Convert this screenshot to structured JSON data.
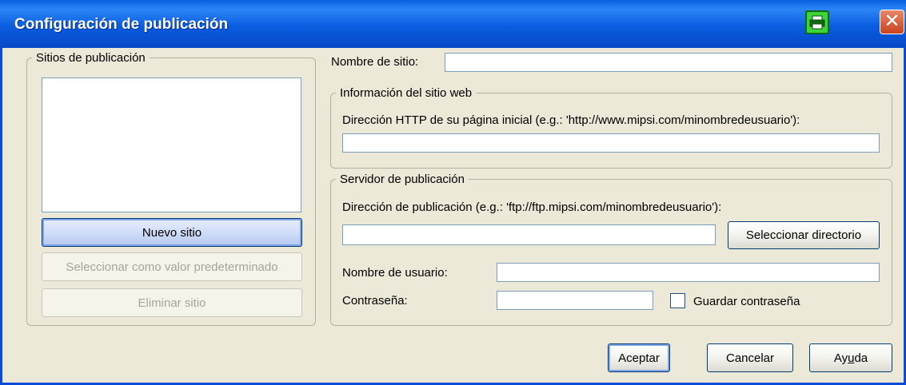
{
  "window": {
    "title": "Configuración de publicación",
    "close_glyph": "✕",
    "app_icon": "printer-icon",
    "accent": "#0a4bd8"
  },
  "sites_group": {
    "legend": "Sitios de publicación",
    "new_site_label": "Nuevo sitio",
    "set_default_label": "Seleccionar como valor predeterminado",
    "delete_site_label": "Eliminar sitio"
  },
  "site_name": {
    "label": "Nombre de sitio:",
    "value": ""
  },
  "website_group": {
    "legend": "Información del sitio web",
    "http_label": "Dirección HTTP de su página inicial (e.g.: 'http://www.mipsi.com/minombredeusuario'):",
    "http_value": ""
  },
  "server_group": {
    "legend": "Servidor de publicación",
    "publish_label": "Dirección de publicación (e.g.: 'ftp://ftp.mipsi.com/minombredeusuario'):",
    "publish_value": "",
    "select_dir_label": "Seleccionar directorio",
    "username_label": "Nombre de usuario:",
    "username_value": "",
    "password_label": "Contraseña:",
    "password_value": "",
    "save_password_label": "Guardar contraseña",
    "save_password_checked": false
  },
  "footer": {
    "ok_label": "Aceptar",
    "cancel_label": "Cancelar",
    "help_label_pre": "Ay",
    "help_label_ul": "u",
    "help_label_post": "da"
  }
}
